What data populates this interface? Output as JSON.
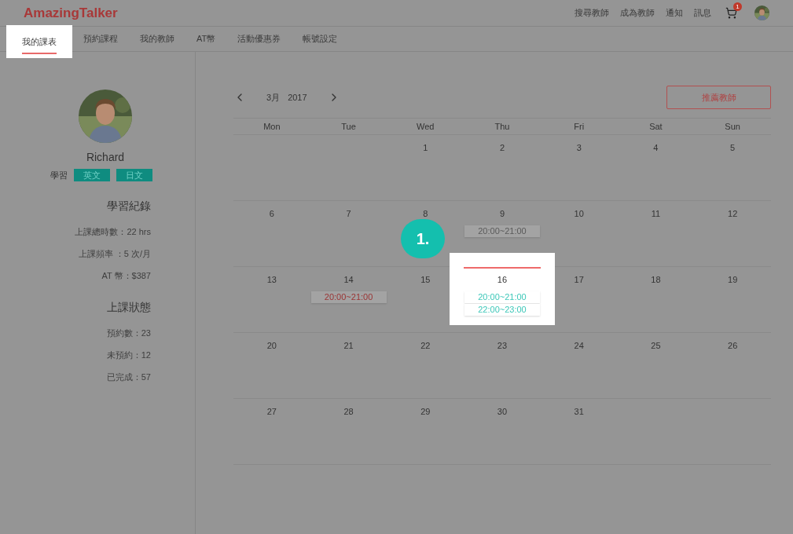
{
  "logo": "AmazingTalker",
  "top_links": [
    "搜尋教師",
    "成為教師",
    "通知",
    "訊息"
  ],
  "cart": {
    "badge": "1"
  },
  "tabs": [
    {
      "label": "我的課表",
      "selected": true
    },
    {
      "label": "預約課程",
      "selected": false
    },
    {
      "label": "我的教師",
      "selected": false
    },
    {
      "label": "AT幣",
      "selected": false
    },
    {
      "label": "活動優惠券",
      "selected": false
    },
    {
      "label": "帳號設定",
      "selected": false
    }
  ],
  "profile": {
    "name": "Richard",
    "learning_label": "學習",
    "languages": [
      "英文",
      "日文"
    ]
  },
  "sections": [
    {
      "title": "學習紀錄",
      "lines": [
        "上課總時數：22 hrs",
        "上課頻率 ：5 次/月",
        "AT 幣：$387"
      ]
    },
    {
      "title": "上課狀態",
      "lines": [
        "預約數：23",
        "未預約：12",
        "已完成：57"
      ]
    }
  ],
  "calendar": {
    "month": "3月",
    "year": "2017",
    "recommend_button": "推薦教師",
    "weekdays": [
      "Mon",
      "Tue",
      "Wed",
      "Thu",
      "Fri",
      "Sat",
      "Sun"
    ],
    "weeks": [
      [
        {
          "kind": "blank"
        },
        {
          "kind": "blank"
        },
        {
          "kind": "day",
          "day": "1",
          "highlighted": false
        },
        {
          "kind": "day",
          "day": "2",
          "highlighted": false
        },
        {
          "kind": "day",
          "day": "3",
          "highlighted": false
        },
        {
          "kind": "day",
          "day": "4",
          "highlighted": false
        },
        {
          "kind": "day",
          "day": "5",
          "highlighted": false
        }
      ],
      [
        {
          "kind": "day",
          "day": "6",
          "highlighted": false
        },
        {
          "kind": "day",
          "day": "7",
          "highlighted": false
        },
        {
          "kind": "day",
          "day": "8",
          "highlighted": false
        },
        {
          "kind": "day",
          "day": "9",
          "highlighted": false,
          "events": [
            {
              "time": "20:00~21:00",
              "color": "#5a5a5a"
            }
          ]
        },
        {
          "kind": "day",
          "day": "10",
          "highlighted": false
        },
        {
          "kind": "day",
          "day": "11",
          "highlighted": false
        },
        {
          "kind": "day",
          "day": "12",
          "highlighted": false
        }
      ],
      [
        {
          "kind": "day",
          "day": "13",
          "highlighted": false
        },
        {
          "kind": "day",
          "day": "14",
          "highlighted": false,
          "events": [
            {
              "time": "20:00~21:00",
              "color": "#9a3434"
            }
          ]
        },
        {
          "kind": "day",
          "day": "15",
          "highlighted": false
        },
        {
          "kind": "day",
          "day": "16",
          "highlighted": true,
          "events": [
            {
              "time": "20:00~21:00",
              "color": "#3cc7b8"
            },
            {
              "time": "22:00~23:00",
              "color": "#3cc7b8"
            }
          ]
        },
        {
          "kind": "day",
          "day": "17",
          "highlighted": false
        },
        {
          "kind": "day",
          "day": "18",
          "highlighted": false
        },
        {
          "kind": "day",
          "day": "19",
          "highlighted": false
        }
      ],
      [
        {
          "kind": "day",
          "day": "20",
          "highlighted": false
        },
        {
          "kind": "day",
          "day": "21",
          "highlighted": false
        },
        {
          "kind": "day",
          "day": "22",
          "highlighted": false
        },
        {
          "kind": "day",
          "day": "23",
          "highlighted": false
        },
        {
          "kind": "day",
          "day": "24",
          "highlighted": false
        },
        {
          "kind": "day",
          "day": "25",
          "highlighted": false
        },
        {
          "kind": "day",
          "day": "26",
          "highlighted": false
        }
      ],
      [
        {
          "kind": "day",
          "day": "27",
          "highlighted": false
        },
        {
          "kind": "day",
          "day": "28",
          "highlighted": false
        },
        {
          "kind": "day",
          "day": "29",
          "highlighted": false
        },
        {
          "kind": "day",
          "day": "30",
          "highlighted": false
        },
        {
          "kind": "day",
          "day": "31",
          "highlighted": false
        },
        {
          "kind": "blank"
        },
        {
          "kind": "blank"
        }
      ]
    ]
  },
  "step_marker": "1."
}
